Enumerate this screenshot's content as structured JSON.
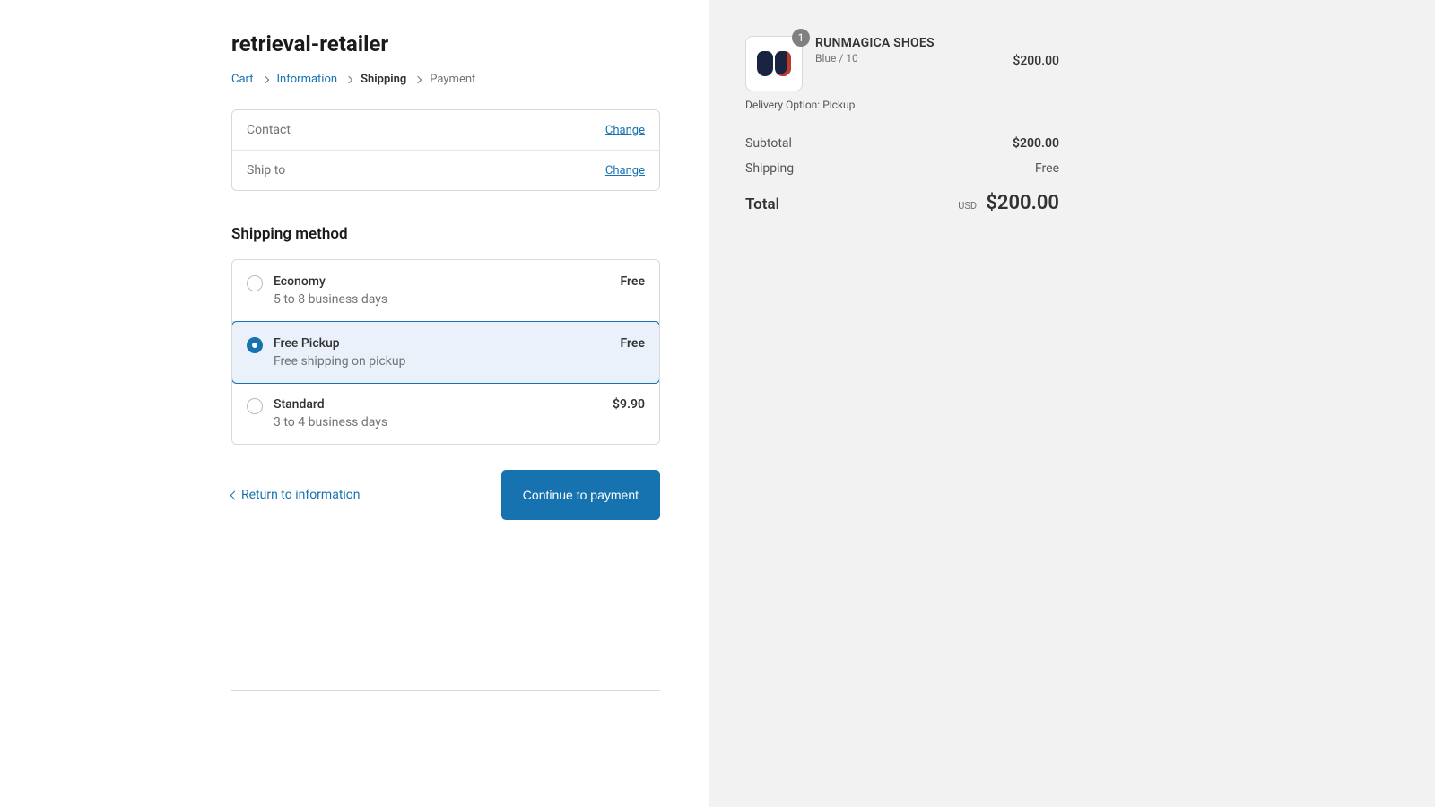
{
  "store": {
    "name": "retrieval-retailer"
  },
  "breadcrumb": {
    "cart": "Cart",
    "information": "Information",
    "shipping": "Shipping",
    "payment": "Payment"
  },
  "review": {
    "contact_label": "Contact",
    "contact_value": "",
    "ship_label": "Ship to",
    "ship_value": "",
    "change": "Change"
  },
  "shipping": {
    "heading": "Shipping method",
    "options": [
      {
        "title": "Economy",
        "sub": "5 to 8 business days",
        "price": "Free",
        "selected": false
      },
      {
        "title": "Free Pickup",
        "sub": "Free shipping on pickup",
        "price": "Free",
        "selected": true
      },
      {
        "title": "Standard",
        "sub": "3 to 4 business days",
        "price": "$9.90",
        "selected": false
      }
    ]
  },
  "actions": {
    "back": "Return to information",
    "continue": "Continue to payment"
  },
  "cart": {
    "item": {
      "qty": "1",
      "name": "RUNMAGICA SHOES",
      "variant": "Blue / 10",
      "delivery": "Delivery Option: Pickup",
      "price": "$200.00"
    },
    "subtotal_label": "Subtotal",
    "subtotal": "$200.00",
    "shipping_label": "Shipping",
    "shipping": "Free",
    "total_label": "Total",
    "currency": "USD",
    "total": "$200.00"
  }
}
